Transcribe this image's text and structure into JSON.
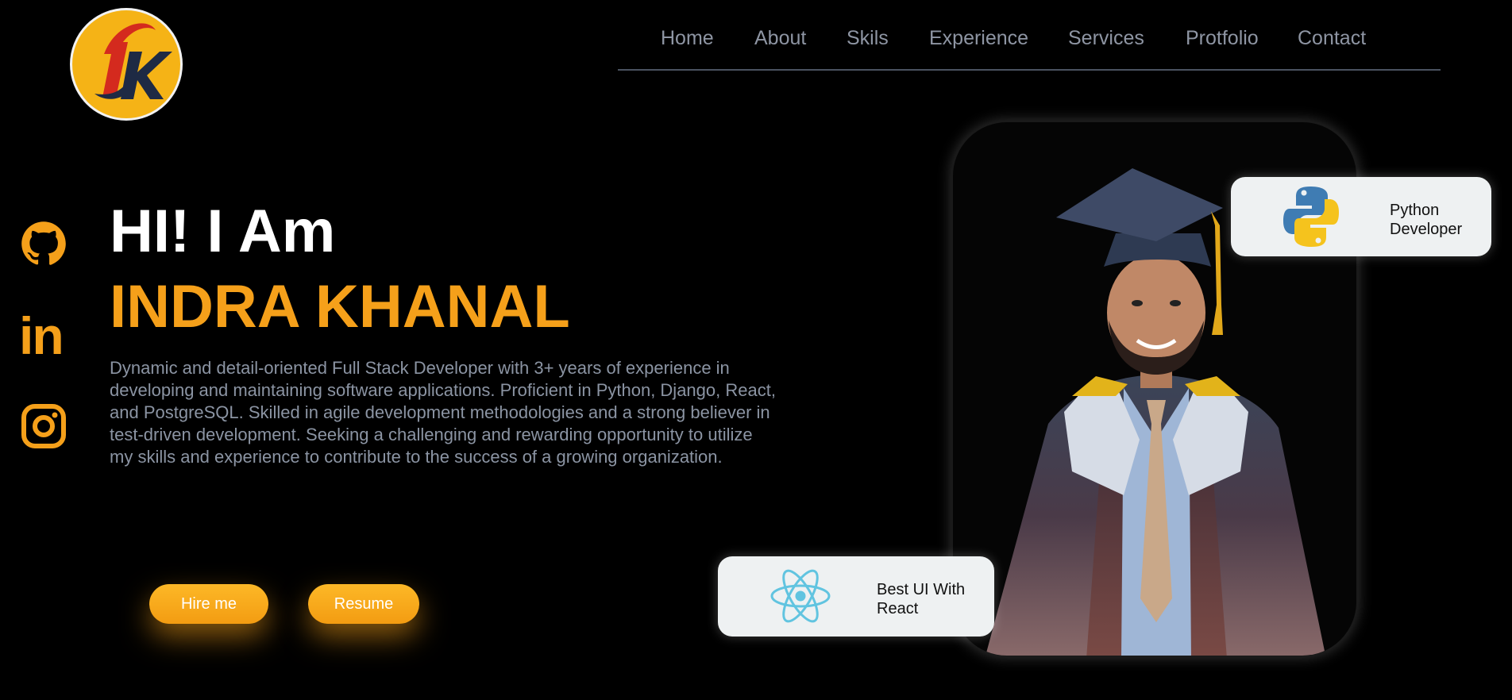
{
  "logo": {
    "text": "Dk"
  },
  "nav": {
    "items": [
      {
        "label": "Home"
      },
      {
        "label": "About"
      },
      {
        "label": "Skils"
      },
      {
        "label": "Experience"
      },
      {
        "label": "Services"
      },
      {
        "label": "Protfolio"
      },
      {
        "label": "Contact"
      }
    ]
  },
  "social": {
    "icons": [
      "github-icon",
      "linkedin-icon",
      "instagram-icon"
    ],
    "linkedin_text": "in"
  },
  "hero": {
    "greeting": "HI! I Am",
    "name": "INDRA KHANAL",
    "bio": "Dynamic and detail-oriented Full Stack Developer with 3+ years of experience in developing and maintaining software applications. Proficient in Python, Django, React, and PostgreSQL. Skilled in agile development methodologies and a strong believer in test-driven development. Seeking a challenging and rewarding opportunity to utilize my skills and experience to contribute to the success of a growing organization.",
    "hire_button": "Hire me",
    "resume_button": "Resume"
  },
  "badges": {
    "python": {
      "text": "Python\nDeveloper",
      "icon": "python-icon"
    },
    "react": {
      "text": "Best UI With\nReact",
      "icon": "react-icon"
    }
  },
  "colors": {
    "accent": "#f5a01a",
    "background": "#000000",
    "nav_text": "#8e95a3",
    "bio_text": "#8b94a3",
    "badge_bg": "#eef1f2"
  }
}
